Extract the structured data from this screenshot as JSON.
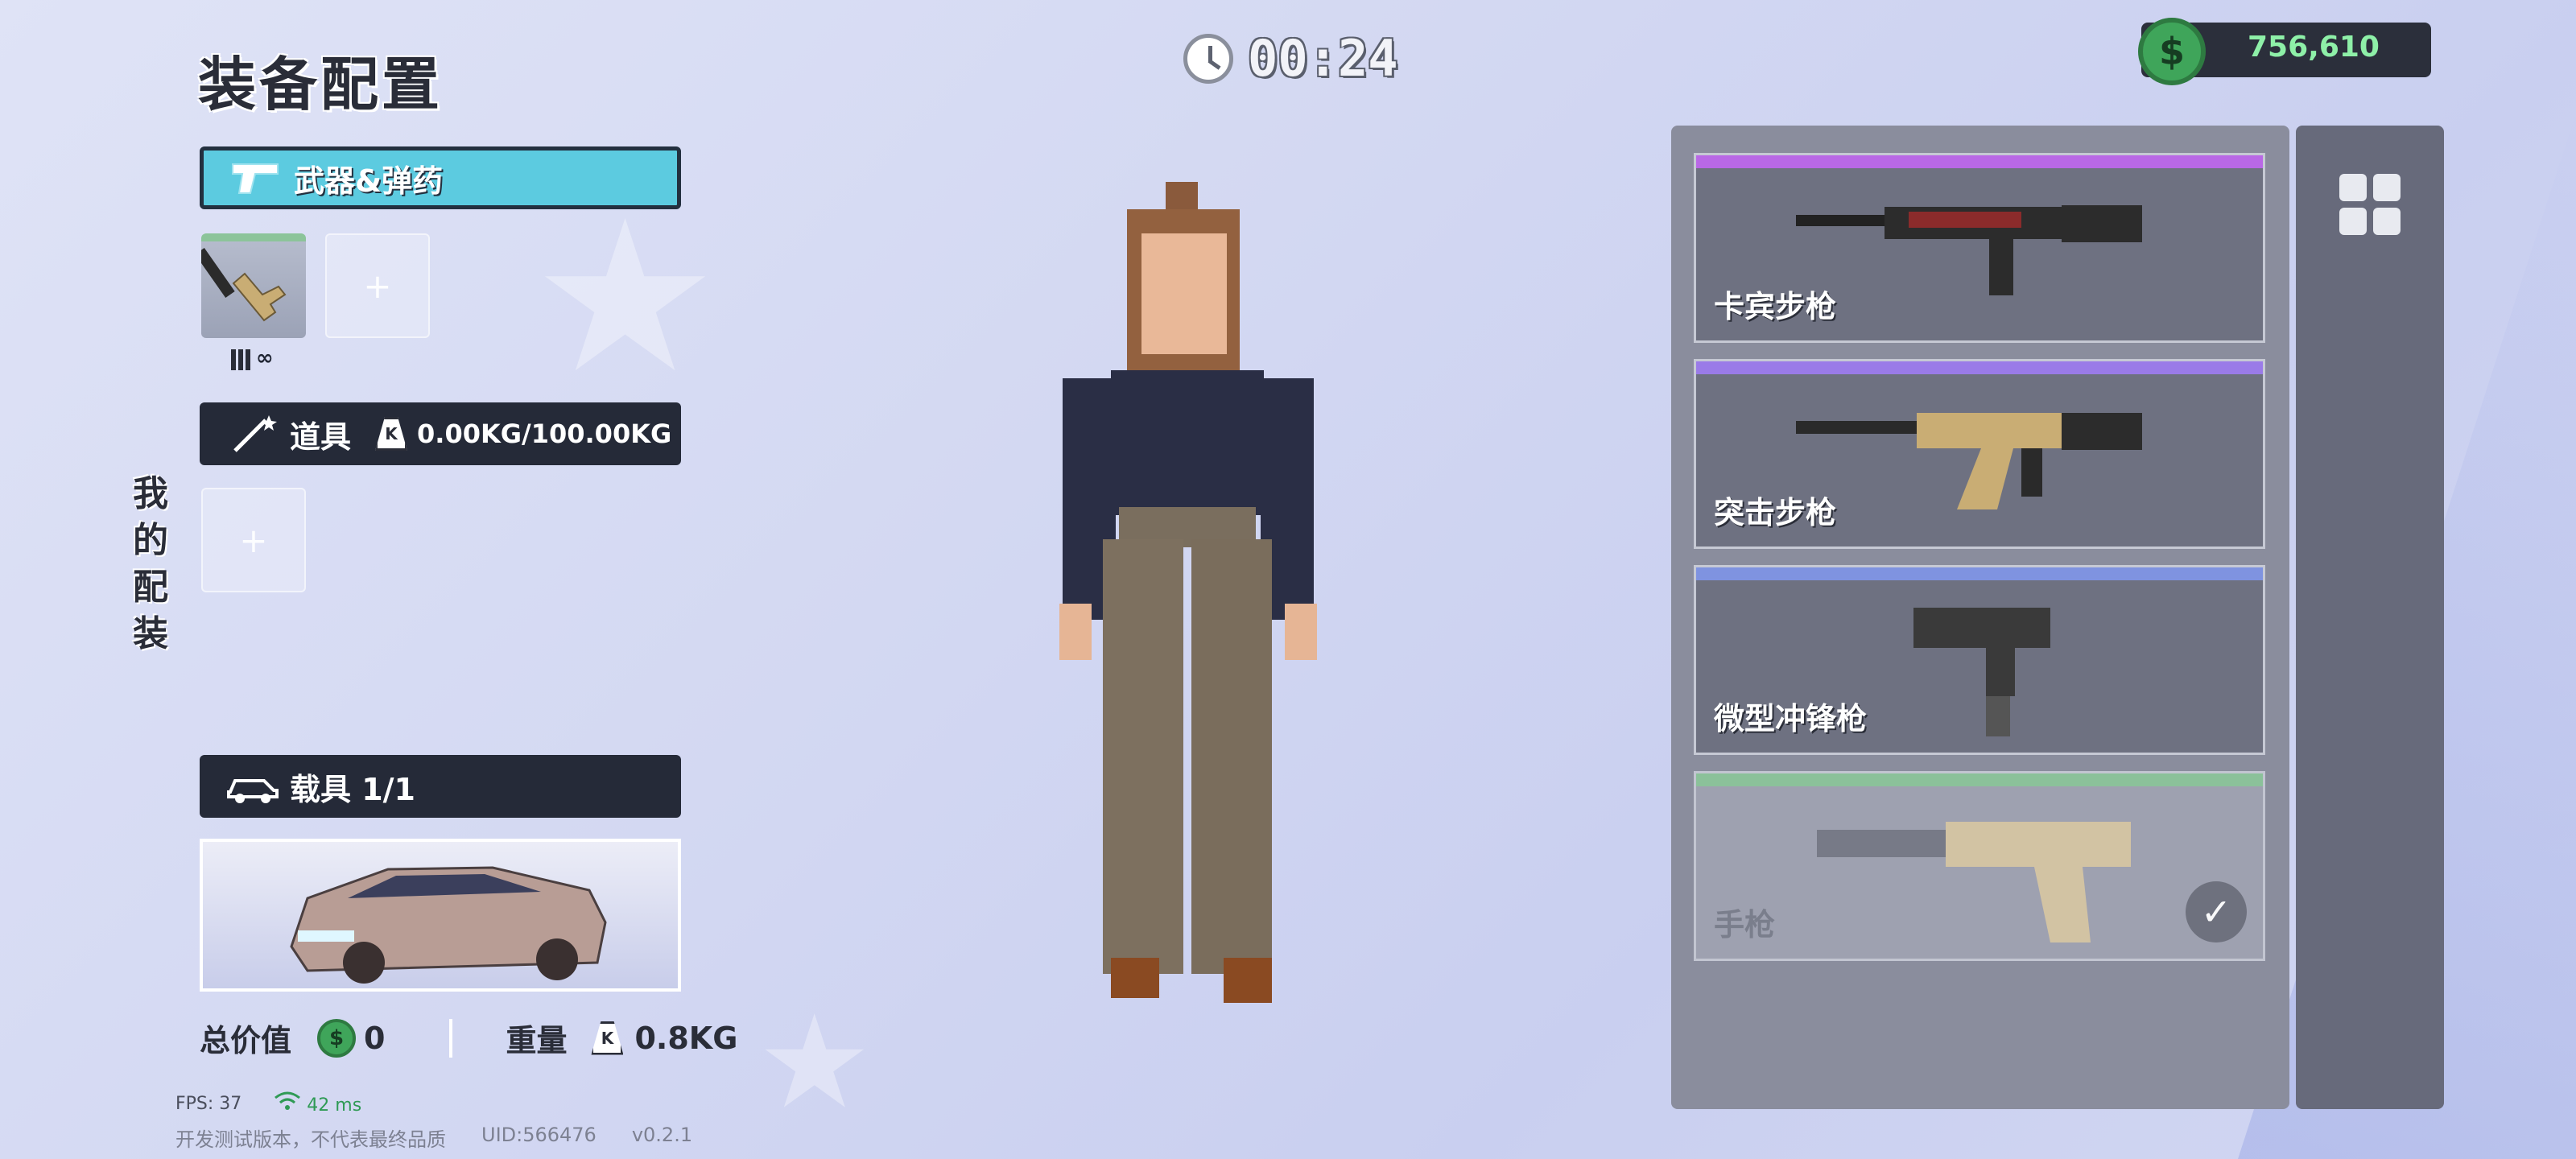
{
  "page_title": "装备配置",
  "timer": "00:24",
  "currency": {
    "symbol": "$",
    "amount": "756,610"
  },
  "loadout_label": [
    "我",
    "的",
    "配",
    "装"
  ],
  "weapons_section": {
    "label": "武器&弹药",
    "ammo_symbol": "∞",
    "add_symbol": "+"
  },
  "items_section": {
    "label": "道具",
    "weight_icon_letter": "K",
    "weight": "0.00KG/100.00KG",
    "add_symbol": "+"
  },
  "vehicle_section": {
    "label": "载具 1/1"
  },
  "summary": {
    "total_value_label": "总价值",
    "total_value": "0",
    "coin_symbol": "$",
    "weight_label": "重量",
    "weight_icon_letter": "K",
    "weight": "0.8KG"
  },
  "stats": {
    "fps": "FPS: 37",
    "ping": "42 ms"
  },
  "dev_note": {
    "text": "开发测试版本，不代表最终品质",
    "uid": "UID:566476",
    "version": "v0.2.1"
  },
  "weapon_list": [
    {
      "label": "卡宾步枪",
      "stripe_color": "#b968e6",
      "owned": false
    },
    {
      "label": "突击步枪",
      "stripe_color": "#9a7be8",
      "owned": false
    },
    {
      "label": "微型冲锋枪",
      "stripe_color": "#7f93e0",
      "owned": false
    },
    {
      "label": "手枪",
      "stripe_color": "#8cc49a",
      "owned": true
    }
  ],
  "colors": {
    "accent_cyan": "#5ccbe0",
    "money_green": "#8ef0a8",
    "panel_dark": "#252a38"
  }
}
